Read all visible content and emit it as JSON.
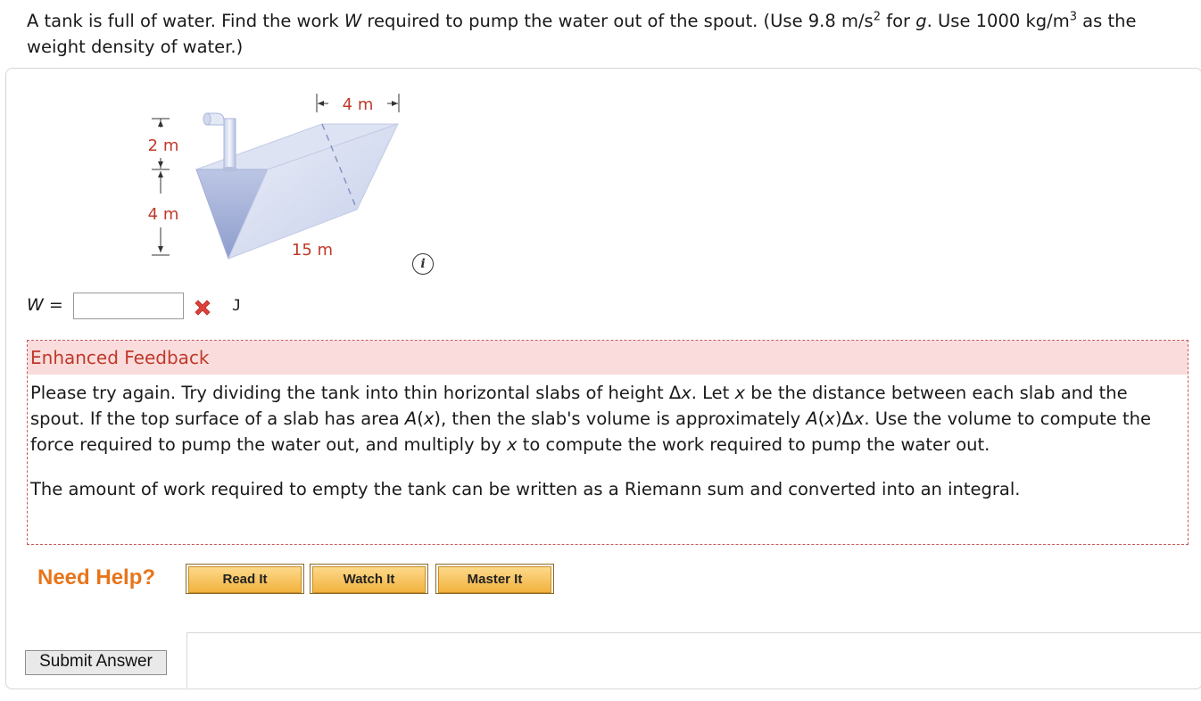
{
  "question": {
    "text_before_g": "A tank is full of water. Find the work ",
    "var_w": "W",
    "text_mid": " required to pump the water out of the spout. (Use 9.8 m/s",
    "sup_2": "2",
    "text_for": " for ",
    "var_g": "g",
    "text_use": ". Use 1000 kg/m",
    "sup_3": "3",
    "text_end": " as the weight density of water.)"
  },
  "figure": {
    "width_label": "4 m",
    "spout_label": "2 m",
    "depth_label": "4 m",
    "length_label": "15 m"
  },
  "answer": {
    "variable": "W",
    "equals": " =",
    "value": "",
    "unit": "J",
    "status": "incorrect"
  },
  "feedback": {
    "header": "Enhanced Feedback",
    "p1_a": "Please try again. Try dividing the tank into thin horizontal slabs of height Δ",
    "p1_x1": "x",
    "p1_b": ". Let ",
    "p1_x2": "x",
    "p1_c": " be the distance between each slab and the spout. If the top surface of a slab has area ",
    "p1_A1": "A",
    "p1_d": "(",
    "p1_x3": "x",
    "p1_e": "), then the slab's volume is approximately ",
    "p1_A2": "A",
    "p1_f": "(",
    "p1_x4": "x",
    "p1_g": ")Δ",
    "p1_x5": "x",
    "p1_h": ". Use the volume to compute the force required to pump the water out, and multiply by ",
    "p1_x6": "x",
    "p1_i": " to compute the work required to pump the water out.",
    "p2": "The amount of work required to empty the tank can be written as a Riemann sum and converted into an integral."
  },
  "help": {
    "label": "Need Help?",
    "buttons": [
      "Read It",
      "Watch It",
      "Master It"
    ]
  },
  "submit_label": "Submit Answer",
  "colors": {
    "accent_red": "#c0392b",
    "help_orange": "#e8751a",
    "feedback_bg": "#fadcdc"
  }
}
